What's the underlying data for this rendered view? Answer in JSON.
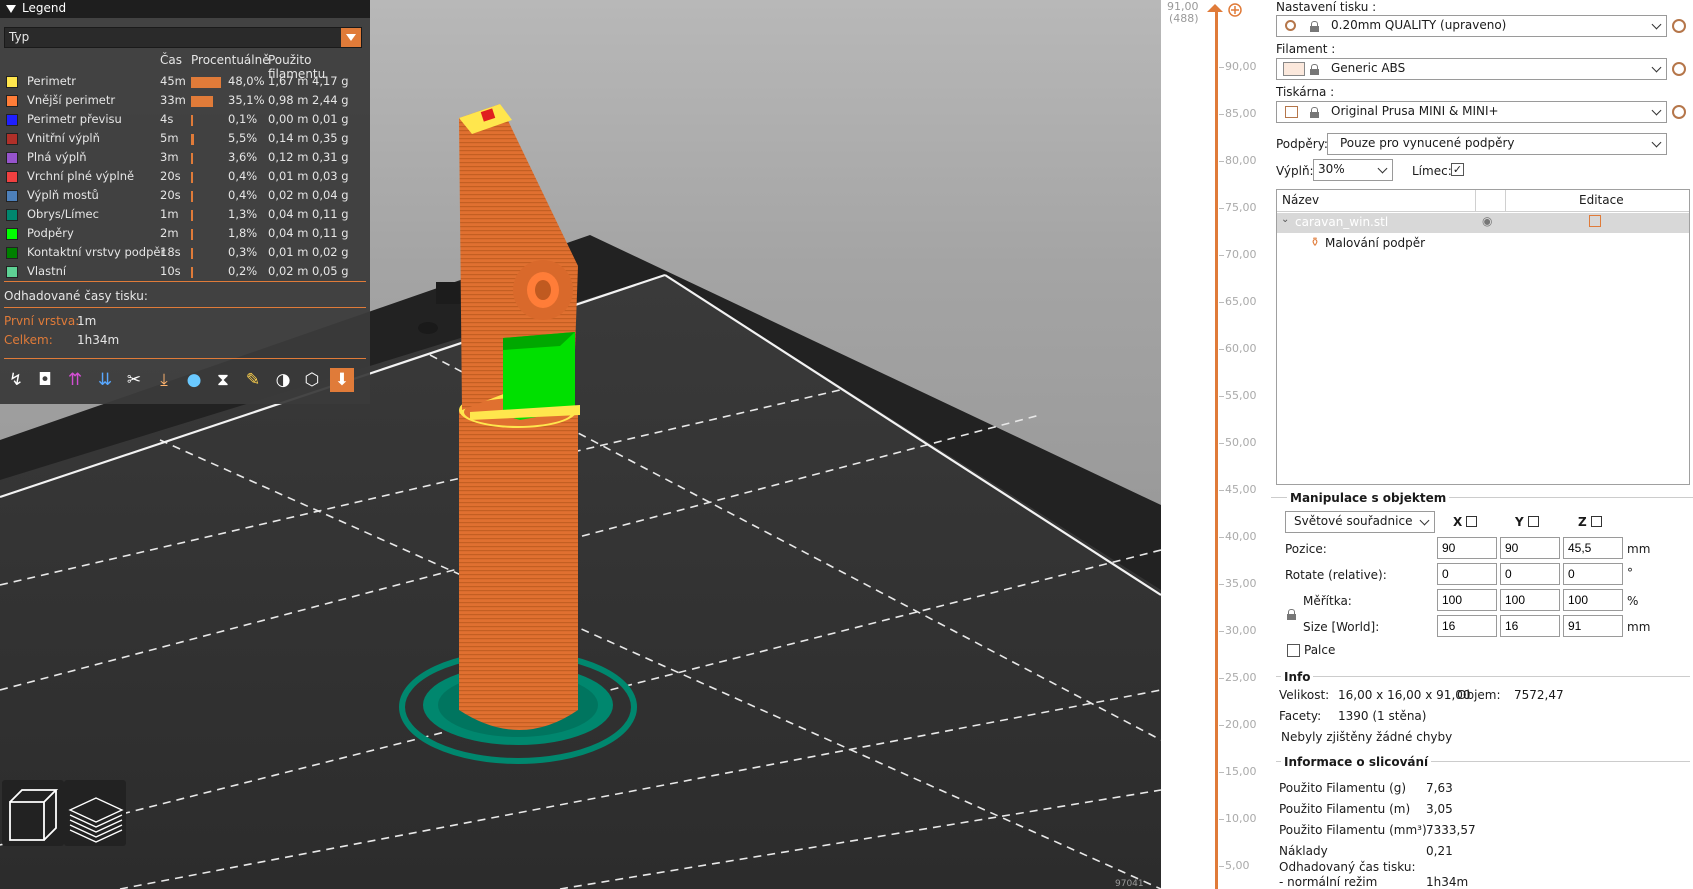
{
  "legend": {
    "title": "Legend",
    "type_select": "Typ",
    "headers": {
      "time": "Čas",
      "percent": "Procentuálně",
      "usage": "Použito filamentu"
    },
    "items": [
      {
        "name": "Perimetr",
        "time": "45m",
        "pct": "48,0%",
        "pct_value": 48.0,
        "len": "1,67 m",
        "weight": "4,17 g",
        "color": "#ffe64d"
      },
      {
        "name": "Vnější perimetr",
        "time": "33m",
        "pct": "35,1%",
        "pct_value": 35.1,
        "len": "0,98 m",
        "weight": "2,44 g",
        "color": "#ff7d38"
      },
      {
        "name": "Perimetr převisu",
        "time": "4s",
        "pct": "0,1%",
        "pct_value": 0.1,
        "len": "0,00 m",
        "weight": "0,01 g",
        "color": "#1f1fff"
      },
      {
        "name": "Vnitřní výplň",
        "time": "5m",
        "pct": "5,5%",
        "pct_value": 5.5,
        "len": "0,14 m",
        "weight": "0,35 g",
        "color": "#b03029"
      },
      {
        "name": "Plná výplň",
        "time": "3m",
        "pct": "3,6%",
        "pct_value": 3.6,
        "len": "0,12 m",
        "weight": "0,31 g",
        "color": "#9654cc"
      },
      {
        "name": "Vrchní plné výplně",
        "time": "20s",
        "pct": "0,4%",
        "pct_value": 0.4,
        "len": "0,01 m",
        "weight": "0,03 g",
        "color": "#f04040"
      },
      {
        "name": "Výplň mostů",
        "time": "20s",
        "pct": "0,4%",
        "pct_value": 0.4,
        "len": "0,02 m",
        "weight": "0,04 g",
        "color": "#4d80ba"
      },
      {
        "name": "Obrys/Límec",
        "time": "1m",
        "pct": "1,3%",
        "pct_value": 1.3,
        "len": "0,04 m",
        "weight": "0,11 g",
        "color": "#00876e"
      },
      {
        "name": "Podpěry",
        "time": "2m",
        "pct": "1,8%",
        "pct_value": 1.8,
        "len": "0,04 m",
        "weight": "0,11 g",
        "color": "#00ff00"
      },
      {
        "name": "Kontaktní vrstvy podpěr",
        "time": "18s",
        "pct": "0,3%",
        "pct_value": 0.3,
        "len": "0,01 m",
        "weight": "0,02 g",
        "color": "#008000"
      },
      {
        "name": "Vlastní",
        "time": "10s",
        "pct": "0,2%",
        "pct_value": 0.2,
        "len": "0,02 m",
        "weight": "0,05 g",
        "color": "#5ed194"
      }
    ],
    "estimated_label": "Odhadované časy tisku:",
    "first_layer_label": "První vrstva:",
    "first_layer_value": "1m",
    "total_label": "Celkem:",
    "total_value": "1h34m",
    "tool_icons": [
      "travel-icon",
      "wipe-icon",
      "retractions-icon",
      "deretractions-icon",
      "seams-icon",
      "tool-changes-icon",
      "color-changes-icon",
      "pause-icon",
      "custom-gcode-icon",
      "center-of-gravity-icon",
      "shells-icon",
      "tool-marker-icon"
    ]
  },
  "slider": {
    "top_value": "91,00",
    "top_layer": "(488)",
    "labels": [
      "90,00",
      "85,00",
      "80,00",
      "75,00",
      "70,00",
      "65,00",
      "60,00",
      "55,00",
      "50,00",
      "45,00",
      "40,00",
      "35,00",
      "30,00",
      "25,00",
      "20,00",
      "15,00",
      "10,00",
      "5,00"
    ]
  },
  "sidebar": {
    "print_settings_label": "Nastavení tisku :",
    "print_settings_value": "0.20mm QUALITY (upraveno)",
    "filament_label": "Filament :",
    "filament_value": "Generic ABS",
    "filament_color": "#fbe8dc",
    "printer_label": "Tiskárna :",
    "printer_value": "Original Prusa MINI & MINI+",
    "supports_label": "Podpěry:",
    "supports_value": "Pouze pro vynucené podpěry",
    "infill_label": "Výplň:",
    "infill_value": "30%",
    "brim_label": "Límec:",
    "brim_checked": true,
    "list_header_name": "Název",
    "list_header_edit": "Editace",
    "object_name": "caravan_win.stl",
    "object_child": "Malování podpěr",
    "manip_title": "Manipulace s objektem",
    "coord_select": "Světové souřadnice",
    "axis_x": "X",
    "axis_y": "Y",
    "axis_z": "Z",
    "position_label": "Pozice:",
    "position": [
      "90",
      "90",
      "45,5"
    ],
    "position_unit": "mm",
    "rotate_label": "Rotate (relative):",
    "rotate": [
      "0",
      "0",
      "0"
    ],
    "rotate_unit": "°",
    "scale_label": "Měřítka:",
    "scale": [
      "100",
      "100",
      "100"
    ],
    "scale_unit": "%",
    "size_label": "Size [World]:",
    "size": [
      "16",
      "16",
      "91"
    ],
    "size_unit": "mm",
    "inches_label": "Palce",
    "info_title": "Info",
    "size_info_label": "Velikost:",
    "size_info_value": "16,00 x 16,00 x 91,00",
    "volume_label": "Objem:",
    "volume_value": "7572,47",
    "facets_label": "Facety:",
    "facets_value": "1390 (1 stěna)",
    "errors_text": "Nebyly zjištěny žádné chyby",
    "slice_title": "Informace o slicování",
    "slice_rows": [
      {
        "label": "Použito Filamentu (g)",
        "value": "7,63"
      },
      {
        "label": "Použito Filamentu (m)",
        "value": "3,05"
      },
      {
        "label": "Použito Filamentu (mm³)",
        "value": "7333,57"
      },
      {
        "label": "Náklady",
        "value": "0,21"
      }
    ],
    "est_time_label": "Odhadovaný čas tisku:",
    "normal_mode_label": "- normální režim",
    "normal_mode_value": "1h34m"
  }
}
